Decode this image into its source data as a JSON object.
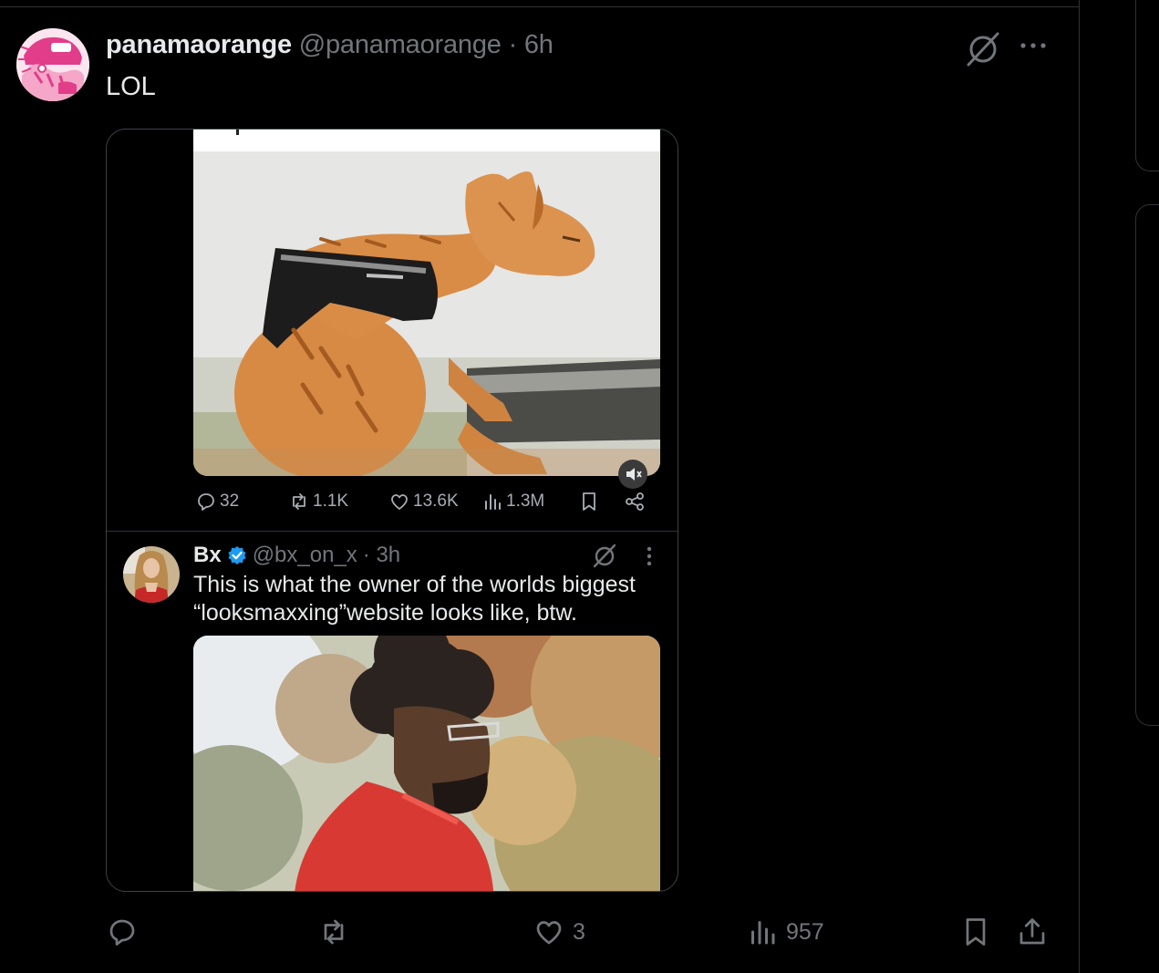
{
  "post": {
    "name": "panamaorange",
    "handle": "@panamaorange",
    "time": "· 6h",
    "text": "LOL"
  },
  "quote": {
    "stats": {
      "replies": "32",
      "reposts": "1.1K",
      "likes": "13.6K",
      "views": "1.3M"
    },
    "inner": {
      "name": "Bx",
      "handle": "@bx_on_x",
      "time": "· 3h",
      "text": "This is what the owner of the worlds biggest “looksmaxxing”website looks like, btw."
    }
  },
  "actions": {
    "likes": "3",
    "views": "957"
  },
  "icons": [
    "grok-icon",
    "more-icon",
    "mute-icon",
    "reply-icon",
    "repost-icon",
    "like-icon",
    "views-icon",
    "bookmark-icon",
    "share-icon",
    "verified-badge-icon"
  ],
  "colors": {
    "background": "#000000",
    "text": "#e7e9ea",
    "muted": "#71767b",
    "border": "#2f3336",
    "verified": "#1d9bf0",
    "avatar_accent": "#e23d8a"
  }
}
